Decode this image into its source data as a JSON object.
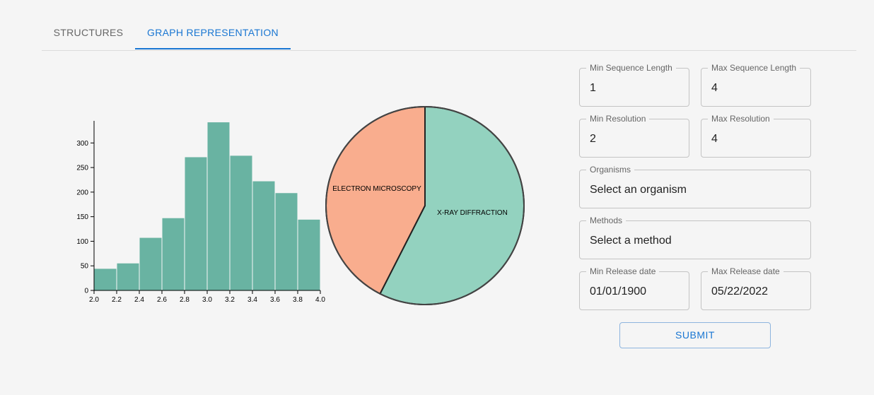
{
  "tabs": [
    {
      "label": "STRUCTURES",
      "active": false
    },
    {
      "label": "GRAPH REPRESENTATION",
      "active": true
    }
  ],
  "chart_data": [
    {
      "type": "bar",
      "bins": [
        2.0,
        2.2,
        2.4,
        2.6,
        2.8,
        3.0,
        3.2,
        3.4,
        3.6,
        3.8,
        4.0
      ],
      "values": [
        44,
        55,
        107,
        147,
        271,
        342,
        274,
        222,
        198,
        144
      ],
      "x_ticks": [
        "2.0",
        "2.2",
        "2.4",
        "2.6",
        "2.8",
        "3.0",
        "3.2",
        "3.4",
        "3.6",
        "3.8",
        "4.0"
      ],
      "y_ticks": [
        "0",
        "50",
        "100",
        "150",
        "200",
        "250",
        "300"
      ],
      "xlim": [
        2.0,
        4.0
      ],
      "ylim": [
        0,
        345
      ],
      "color": "#69b3a2"
    },
    {
      "type": "pie",
      "slices": [
        {
          "label": "X-RAY DIFFRACTION",
          "value": 57.5,
          "color": "#93d2bf"
        },
        {
          "label": "ELECTRON MICROSCOPY",
          "value": 42.5,
          "color": "#f9ad8e"
        }
      ]
    }
  ],
  "form": {
    "min_seq_len": {
      "label": "Min Sequence Length",
      "value": "1"
    },
    "max_seq_len": {
      "label": "Max Sequence Length",
      "value": "4"
    },
    "min_res": {
      "label": "Min Resolution",
      "value": "2"
    },
    "max_res": {
      "label": "Max Resolution",
      "value": "4"
    },
    "organisms": {
      "label": "Organisms",
      "value": "Select an organism"
    },
    "methods": {
      "label": "Methods",
      "value": "Select a method"
    },
    "min_date": {
      "label": "Min Release date",
      "value": "01/01/1900"
    },
    "max_date": {
      "label": "Max Release date",
      "value": "05/22/2022"
    },
    "submit_label": "SUBMIT"
  }
}
